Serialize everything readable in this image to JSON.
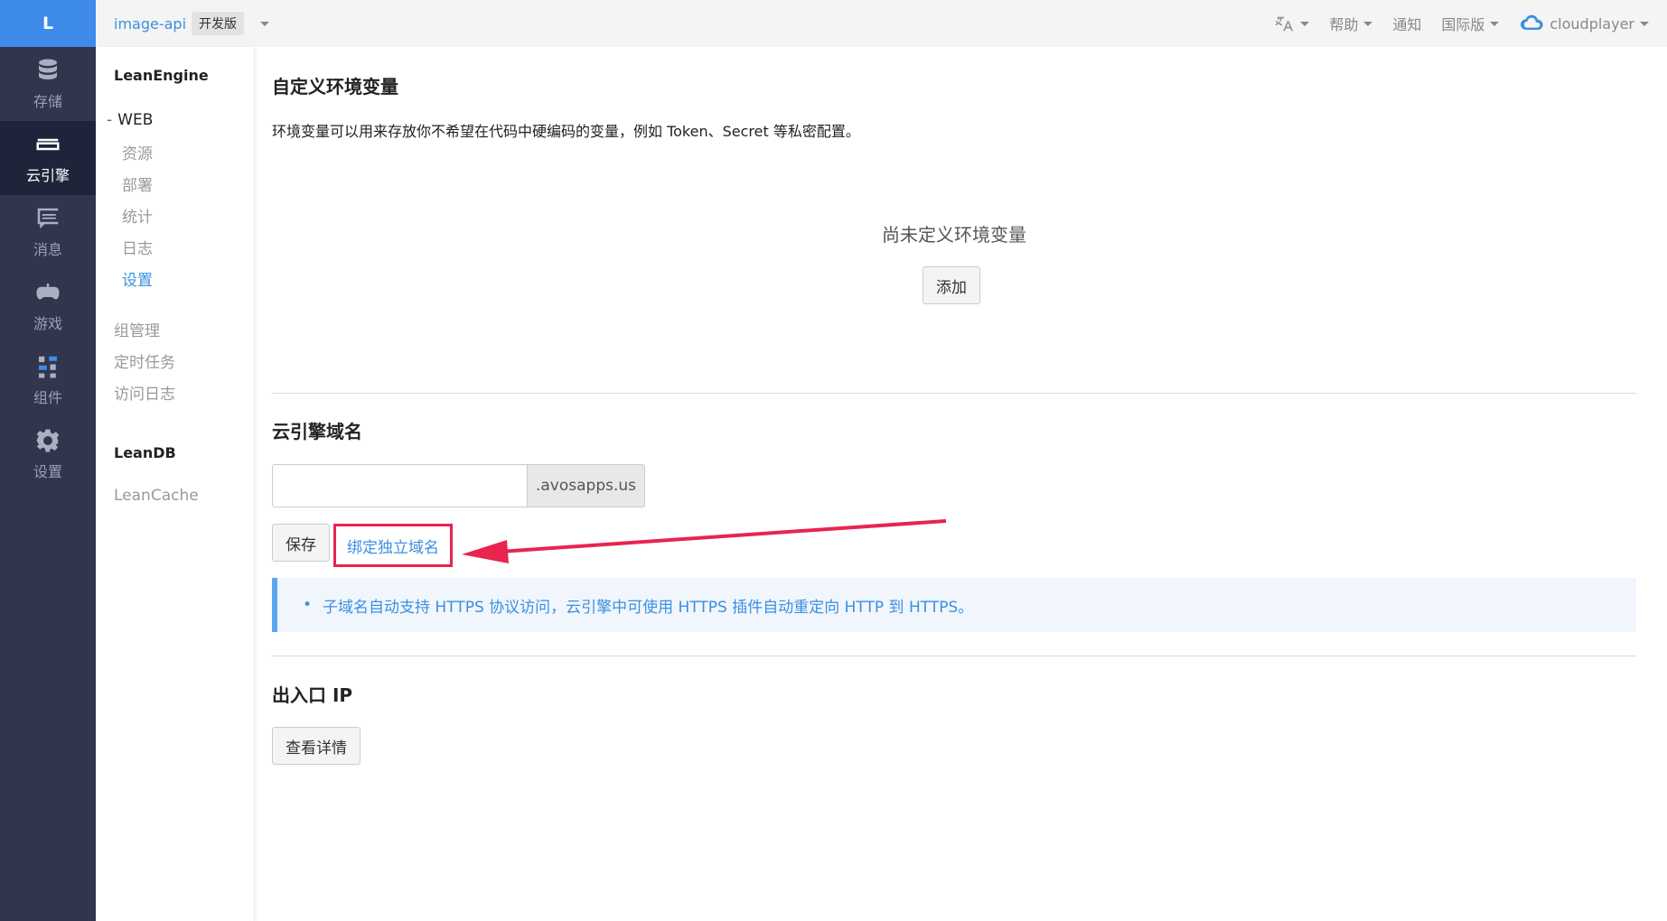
{
  "rail": {
    "logo": "L",
    "items": [
      {
        "label": "存储",
        "icon": "database-icon"
      },
      {
        "label": "云引擎",
        "icon": "cloud-engine-icon",
        "active": true
      },
      {
        "label": "消息",
        "icon": "message-icon"
      },
      {
        "label": "游戏",
        "icon": "gamepad-icon"
      },
      {
        "label": "组件",
        "icon": "components-icon"
      },
      {
        "label": "设置",
        "icon": "gear-icon"
      }
    ]
  },
  "topbar": {
    "app_name": "image-api",
    "plan_badge": "开发版",
    "help": "帮助",
    "notifications": "通知",
    "region": "国际版",
    "user": "cloudplayer"
  },
  "subnav": {
    "section1_title": "LeanEngine",
    "group_web": "WEB",
    "web_items": [
      "资源",
      "部署",
      "统计",
      "日志",
      "设置"
    ],
    "active_web_item": "设置",
    "other_items": [
      "组管理",
      "定时任务",
      "访问日志"
    ],
    "section2_title": "LeanDB",
    "section2_items": [
      "LeanCache"
    ]
  },
  "main": {
    "env_title": "自定义环境变量",
    "env_desc": "环境变量可以用来存放你不希望在代码中硬编码的变量，例如 Token、Secret 等私密配置。",
    "env_empty": "尚未定义环境变量",
    "env_add_button": "添加",
    "domain_title": "云引擎域名",
    "domain_input_value": "",
    "domain_suffix": ".avosapps.us",
    "save_button": "保存",
    "bind_domain_link": "绑定独立域名",
    "domain_info": "子域名自动支持 HTTPS 协议访问，云引擎中可使用 HTTPS 插件自动重定向 HTTP 到 HTTPS。",
    "ip_title": "出入口 IP",
    "ip_details_button": "查看详情"
  },
  "colors": {
    "accent": "#3b8fe0",
    "rail_bg": "#31364c",
    "highlight": "#e8244f"
  }
}
